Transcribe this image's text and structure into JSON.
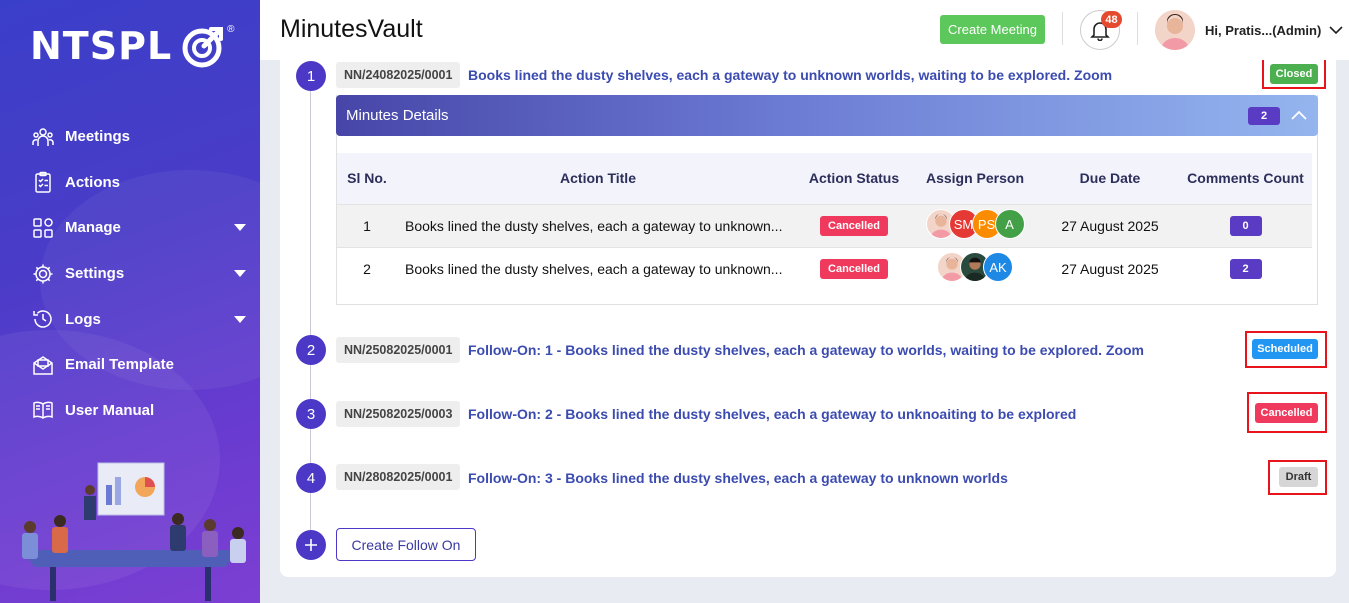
{
  "sidebar": {
    "logo_text": "NTSPL",
    "logo_reg": "®",
    "items": [
      {
        "label": "Meetings",
        "icon": "meetings-icon"
      },
      {
        "label": "Actions",
        "icon": "clipboard-icon"
      },
      {
        "label": "Manage",
        "icon": "grid-icon",
        "has_caret": true
      },
      {
        "label": "Settings",
        "icon": "gear-icon",
        "has_caret": true
      },
      {
        "label": "Logs",
        "icon": "history-icon",
        "has_caret": true
      },
      {
        "label": "Email Template",
        "icon": "envelope-icon"
      },
      {
        "label": "User Manual",
        "icon": "book-icon"
      }
    ]
  },
  "header": {
    "title": "MinutesVault",
    "create_meeting_label": "Create Meeting",
    "notification_count": "48",
    "user_name": "Hi, Pratis...(Admin)"
  },
  "meetings": [
    {
      "number": "1",
      "ref": "NN/24082025/0001",
      "title": "Books lined the dusty shelves, each a gateway to unknown worlds, waiting to be explored. Zoom",
      "status": "Closed",
      "status_color": "#4caf50"
    },
    {
      "number": "2",
      "ref": "NN/25082025/0001",
      "title": "Follow-On: 1 - Books lined the dusty shelves, each a gateway to worlds, waiting to be explored. Zoom",
      "status": "Scheduled",
      "status_color": "#2196f3"
    },
    {
      "number": "3",
      "ref": "NN/25082025/0003",
      "title": "Follow-On: 2 - Books lined the dusty shelves, each a gateway to unknoaiting to be explored",
      "status": "Cancelled",
      "status_color": "#ef3a5d"
    },
    {
      "number": "4",
      "ref": "NN/28082025/0001",
      "title": "Follow-On: 3 - Books lined the dusty shelves, each a gateway to unknown worlds",
      "status": "Draft",
      "status_color": "#d6d6d6"
    }
  ],
  "minutes": {
    "label": "Minutes Details",
    "count": "2",
    "columns": [
      "Sl No.",
      "Action Title",
      "Action Status",
      "Assign Person",
      "Due Date",
      "Comments Count"
    ],
    "rows": [
      {
        "sl": "1",
        "title": "Books lined the dusty shelves, each a gateway to unknown...",
        "status": "Cancelled",
        "due": "27 August 2025",
        "comments": "0",
        "assignees": [
          {
            "initials": "",
            "color": "#f3d4c8"
          },
          {
            "initials": "SM",
            "color": "#e53935"
          },
          {
            "initials": "PS",
            "color": "#fb8c00"
          },
          {
            "initials": "A",
            "color": "#43a047"
          }
        ]
      },
      {
        "sl": "2",
        "title": "Books lined the dusty shelves, each a gateway to unknown...",
        "status": "Cancelled",
        "due": "27 August 2025",
        "comments": "2",
        "assignees": [
          {
            "initials": "",
            "color": "#f3d4c8"
          },
          {
            "initials": "",
            "color": "#2b4a3e"
          },
          {
            "initials": "AK",
            "color": "#1e88e5"
          }
        ]
      }
    ]
  },
  "create_follow_on_label": "Create Follow On",
  "colors": {
    "accent": "#4c38c6",
    "closed": "#4caf50",
    "scheduled": "#2196f3",
    "cancelled": "#ef3a5d",
    "draft": "#d6d6d6",
    "highlight": "#e8141b"
  }
}
